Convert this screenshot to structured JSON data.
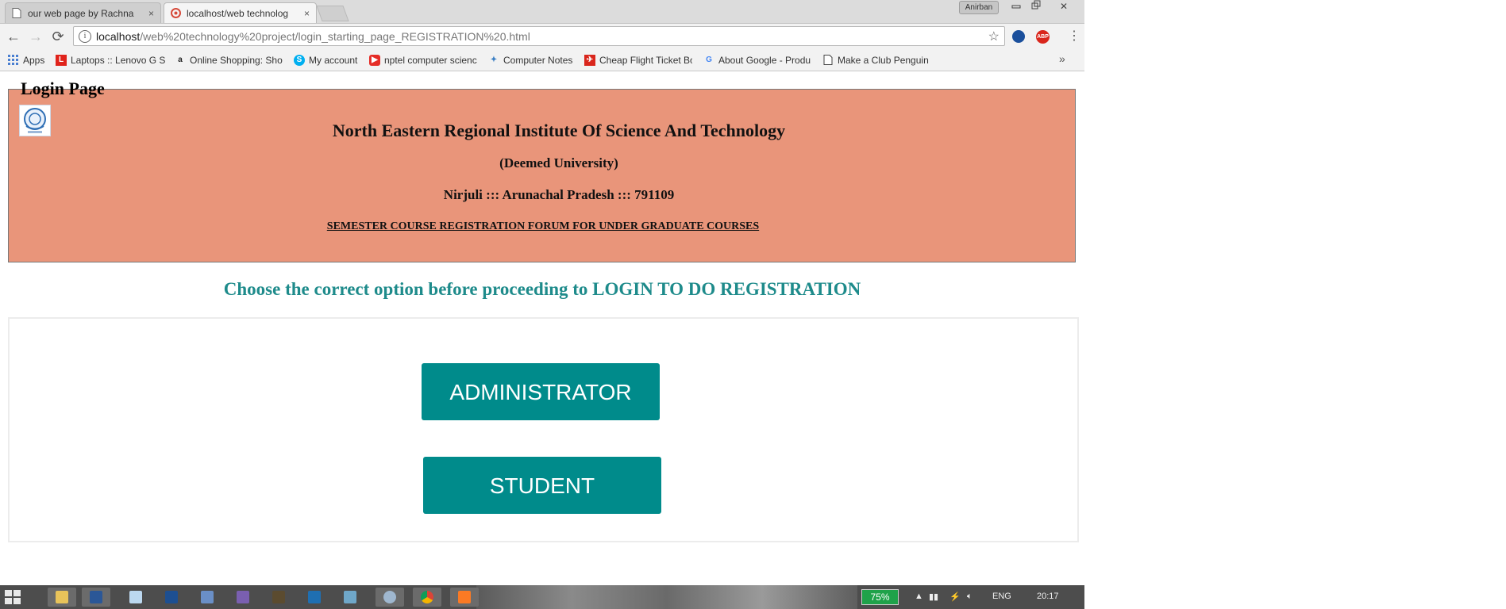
{
  "tabs": [
    {
      "title": "our web page by Rachna",
      "close": "×"
    },
    {
      "title": "localhost/web technolog",
      "close": "×"
    }
  ],
  "window": {
    "user": "Anirban",
    "minimize": "▭",
    "restore": "⧉",
    "close": "✕"
  },
  "toolbar": {
    "back": "←",
    "forward": "→",
    "reload": "⟳",
    "url_host": "localhost",
    "url_path": "/web%20technology%20project/login_starting_page_REGISTRATION%20.html",
    "star": "☆",
    "abp": "ABP",
    "menu": "⋮"
  },
  "bookmarks": [
    {
      "label": "Apps",
      "icon": "apps-grid-icon",
      "color": "#4a7fd1"
    },
    {
      "label": "Laptops :: Lenovo G S",
      "icon": "lenovo-l-icon",
      "color": "#e0231b"
    },
    {
      "label": "Online Shopping: Sho",
      "icon": "amazon-icon",
      "color": "#222222"
    },
    {
      "label": "My account",
      "icon": "skype-icon",
      "color": "#00aff0"
    },
    {
      "label": "nptel computer scienc",
      "icon": "youtube-icon",
      "color": "#e52d27"
    },
    {
      "label": "Computer Notes",
      "icon": "computer-notes-icon",
      "color": "#3b7fc4"
    },
    {
      "label": "Cheap Flight Ticket Bo",
      "icon": "flight-icon",
      "color": "#d9261c"
    },
    {
      "label": "About Google - Produ",
      "icon": "google-icon",
      "color": "#4285f4"
    },
    {
      "label": "Make a Club Penguin",
      "icon": "page-icon",
      "color": "#444444"
    }
  ],
  "bookmarks_more": "»",
  "page": {
    "legend": "Login Page",
    "institute": "North Eastern Regional Institute Of Science And Technology",
    "deemed": "(Deemed University)",
    "address": "Nirjuli ::: Arunachal Pradesh ::: 791109",
    "forum": "SEMESTER COURSE REGISTRATION FORUM FOR UNDER GRADUATE COURSES",
    "choose_prefix": "Choose the correct option before proceeding to",
    "choose_caps": "LOGIN TO DO REGISTRATION",
    "admin_button": "ADMINISTRATOR",
    "student_button": "STUDENT"
  },
  "colors": {
    "header_bg": "#e9957a",
    "accent_teal": "#008b8b",
    "choose_text": "#1e8b8b"
  },
  "taskbar": {
    "battery": "75%",
    "lang": "ENG",
    "time": "20:17"
  }
}
